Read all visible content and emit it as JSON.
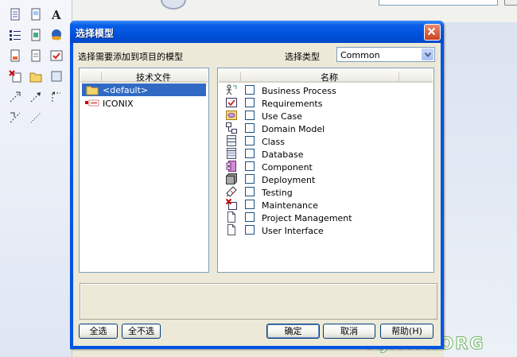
{
  "dialog": {
    "title": "选择模型",
    "prompt_label": "选择需要添加到项目的模型",
    "type_label": "选择类型",
    "type_value": "Common"
  },
  "files_panel": {
    "header": "技术文件",
    "items": [
      {
        "label": "<default>",
        "icon": "folder-icon",
        "selected": true
      },
      {
        "label": "ICONIX",
        "icon": "iconix-icon",
        "selected": false
      }
    ]
  },
  "models_panel": {
    "header": "名称",
    "items": [
      {
        "label": "Business Process",
        "icon": "business-process-icon",
        "checked": false
      },
      {
        "label": "Requirements",
        "icon": "requirements-icon",
        "checked": false
      },
      {
        "label": "Use Case",
        "icon": "use-case-icon",
        "checked": false
      },
      {
        "label": "Domain Model",
        "icon": "domain-model-icon",
        "checked": false
      },
      {
        "label": "Class",
        "icon": "class-icon",
        "checked": false
      },
      {
        "label": "Database",
        "icon": "database-icon",
        "checked": false
      },
      {
        "label": "Component",
        "icon": "component-icon",
        "checked": false
      },
      {
        "label": "Deployment",
        "icon": "deployment-icon",
        "checked": false
      },
      {
        "label": "Testing",
        "icon": "testing-icon",
        "checked": false
      },
      {
        "label": "Maintenance",
        "icon": "maintenance-icon",
        "checked": false
      },
      {
        "label": "Project Management",
        "icon": "project-management-icon",
        "checked": false
      },
      {
        "label": "User Interface",
        "icon": "user-interface-icon",
        "checked": false
      }
    ]
  },
  "buttons": {
    "select_all": "全选",
    "select_none": "全不选",
    "ok": "确定",
    "cancel": "取消",
    "help": "帮助(H)"
  },
  "watermark": "AJAVA.ORG",
  "colors": {
    "title_bar": "#0054e3",
    "selection": "#316ac5",
    "close_button": "#d5532f",
    "dialog_face": "#ece9d8"
  }
}
